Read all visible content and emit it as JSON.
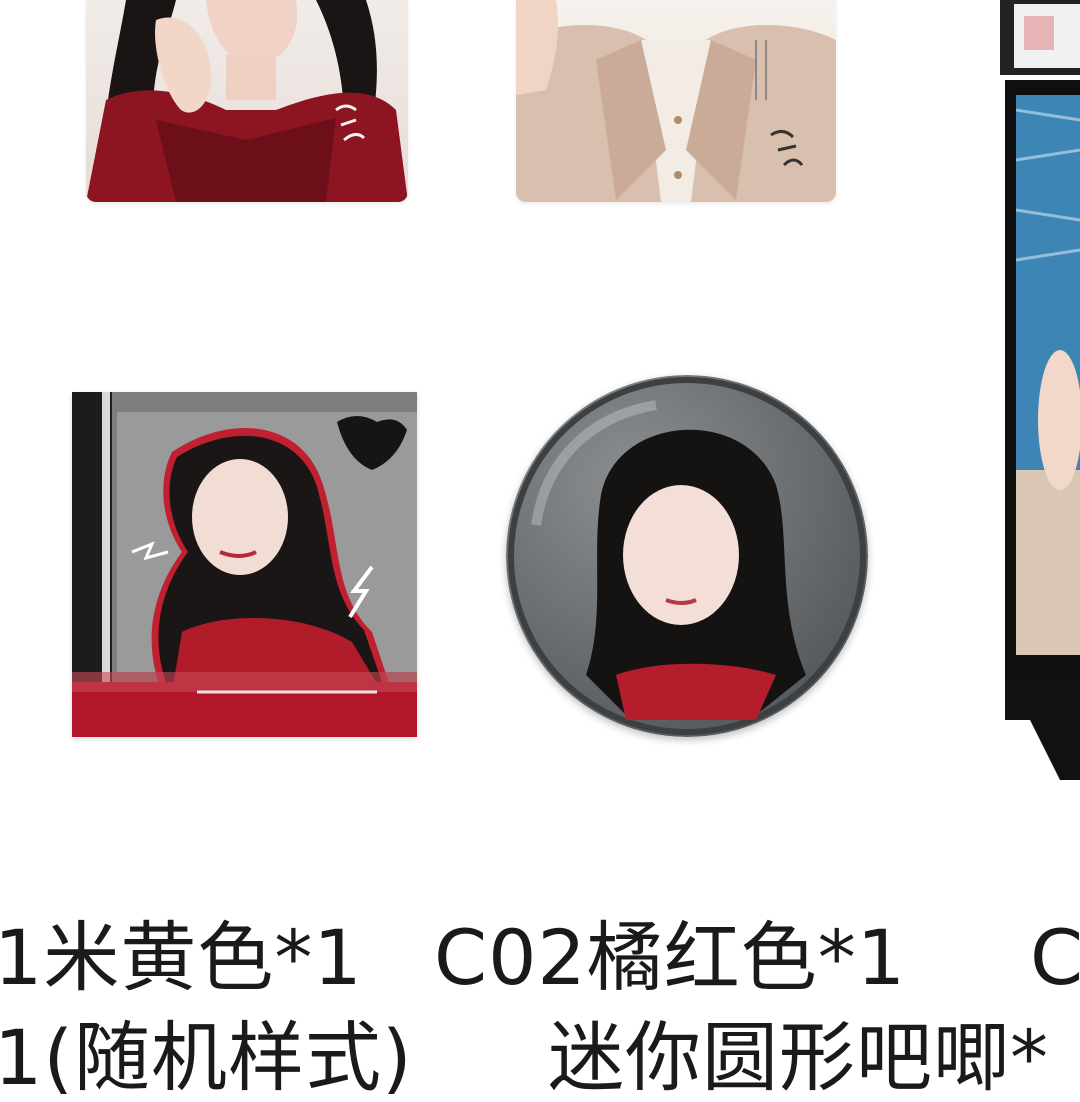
{
  "captions": {
    "row1_left": "1米黄色*1",
    "row1_mid": "C02橘红色*1",
    "row1_right": "C",
    "row2_left": "1(随机样式)",
    "row2_mid": "迷你圆形吧唧*"
  },
  "colors": {
    "background": "#ffffff",
    "accent_red": "#b11a2a",
    "caption_text": "#1a1a1a",
    "badge_gray": "#6e7274",
    "frame_black": "#111111"
  },
  "images": {
    "top_left": "woman-in-red-dress-photo",
    "top_middle": "woman-in-beige-blazer-photo",
    "square_card": "woman-with-braids-grayscale-card",
    "round_badge": "woman-with-braids-round-badge",
    "right_frame": "photo-frame-stand-sea-photo"
  }
}
